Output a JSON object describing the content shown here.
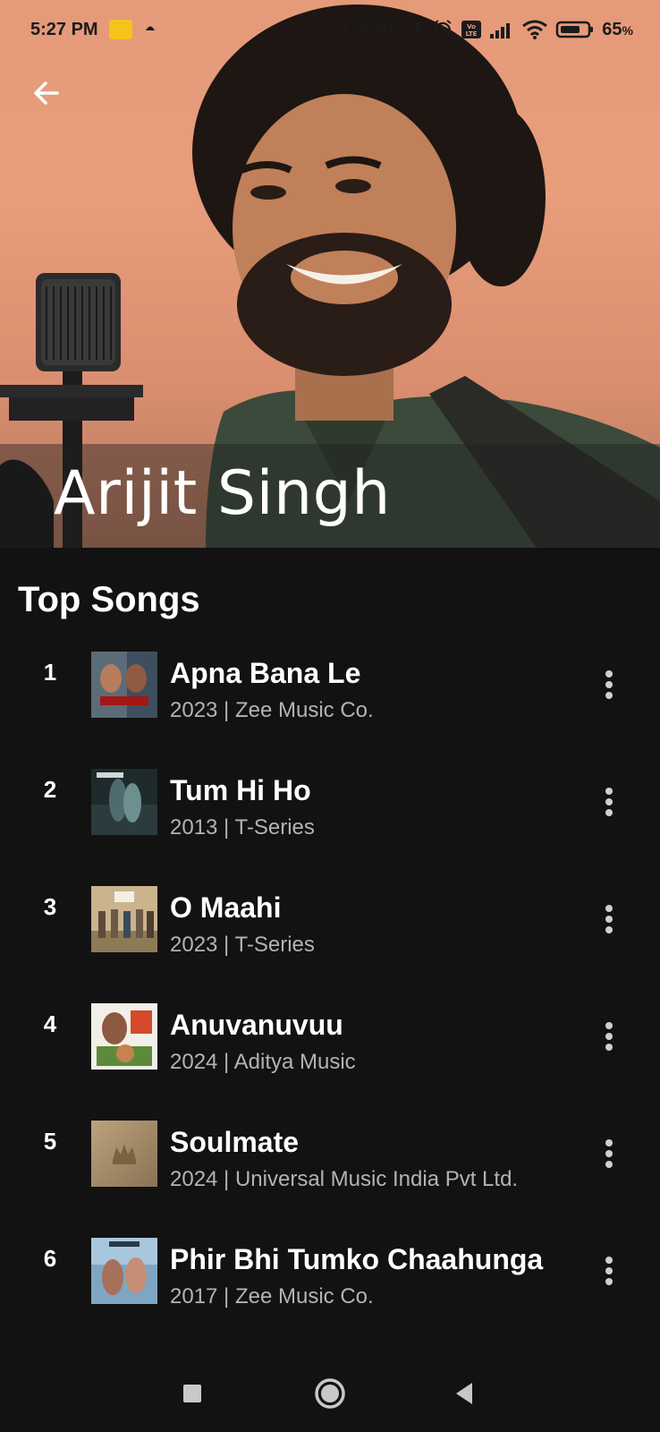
{
  "status_bar": {
    "time": "5:27 PM",
    "network_speed": "4.7KB/s",
    "battery_percent": "65",
    "battery_unit": "%",
    "icons": [
      "notification-icon",
      "upload-icon",
      "bluetooth-icon",
      "alarm-icon",
      "volte-icon",
      "signal-icon",
      "wifi-icon",
      "battery-icon"
    ]
  },
  "header": {
    "artist_name": "Arijit Singh",
    "back_icon": "back-arrow-icon"
  },
  "top_songs": {
    "title": "Top Songs",
    "songs": [
      {
        "rank": "1",
        "title": "Apna Bana Le",
        "subtitle": "2023 | Zee Music Co."
      },
      {
        "rank": "2",
        "title": "Tum Hi Ho",
        "subtitle": "2013 | T-Series"
      },
      {
        "rank": "3",
        "title": "O Maahi",
        "subtitle": "2023 | T-Series"
      },
      {
        "rank": "4",
        "title": "Anuvanuvuu",
        "subtitle": "2024 | Aditya Music"
      },
      {
        "rank": "5",
        "title": "Soulmate",
        "subtitle": "2024 | Universal Music India Pvt Ltd."
      },
      {
        "rank": "6",
        "title": "Phir Bhi Tumko Chaahunga",
        "subtitle": "2017 | Zee Music Co."
      }
    ]
  },
  "nav_bar": {
    "icons": [
      "recents-icon",
      "home-icon",
      "back-icon"
    ]
  },
  "colors": {
    "background": "#121212",
    "hero_tint": "#e59a79",
    "subtitle": "#b3b3b3"
  }
}
